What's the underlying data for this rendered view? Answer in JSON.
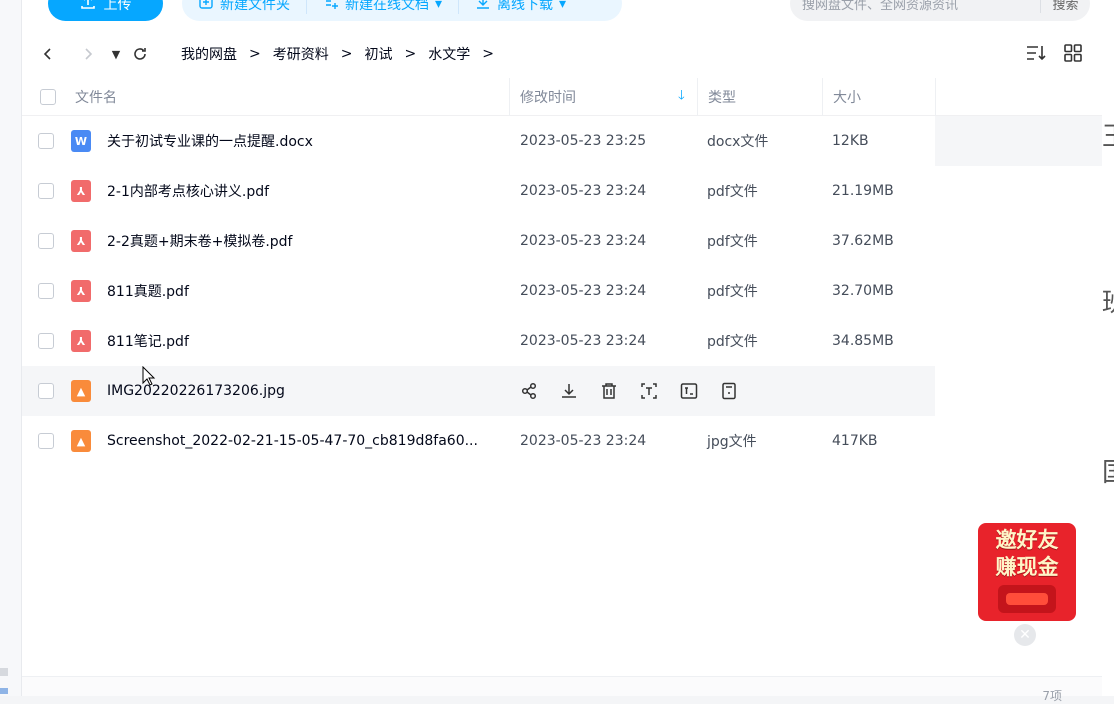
{
  "toolbar": {
    "upload_label": "上传",
    "new_folder_label": "新建文件夹",
    "new_online_doc_label": "新建在线文档",
    "offline_download_label": "离线下载",
    "search_placeholder": "搜网盘文件、全网资源资讯",
    "search_button": "搜索"
  },
  "breadcrumb": {
    "items": [
      "我的网盘",
      "考研资料",
      "初试",
      "水文学"
    ],
    "separator": ">"
  },
  "table": {
    "headers": {
      "name": "文件名",
      "time": "修改时间",
      "type": "类型",
      "size": "大小"
    },
    "rows": [
      {
        "icon": "word-file-icon",
        "name": "关于初试专业课的一点提醒.docx",
        "time": "2023-05-23 23:25",
        "type": "docx文件",
        "size": "12KB"
      },
      {
        "icon": "pdf-file-icon",
        "name": "2-1内部考点核心讲义.pdf",
        "time": "2023-05-23 23:24",
        "type": "pdf文件",
        "size": "21.19MB"
      },
      {
        "icon": "pdf-file-icon",
        "name": "2-2真题+期末卷+模拟卷.pdf",
        "time": "2023-05-23 23:24",
        "type": "pdf文件",
        "size": "37.62MB"
      },
      {
        "icon": "pdf-file-icon",
        "name": "811真题.pdf",
        "time": "2023-05-23 23:24",
        "type": "pdf文件",
        "size": "32.70MB"
      },
      {
        "icon": "pdf-file-icon",
        "name": "811笔记.pdf",
        "time": "2023-05-23 23:24",
        "type": "pdf文件",
        "size": "34.85MB"
      },
      {
        "icon": "image-file-icon",
        "name": "IMG20220226173206.jpg",
        "time": "",
        "type": "",
        "size": ""
      },
      {
        "icon": "image-file-icon",
        "name": "Screenshot_2022-02-21-15-05-47-70_cb819d8fa60...",
        "time": "2023-05-23 23:24",
        "type": "jpg文件",
        "size": "417KB"
      }
    ]
  },
  "promo": {
    "line1": "邀好友",
    "line2": "赚现金"
  },
  "footer": {
    "count": "7项"
  },
  "right_strip": [
    "王",
    "班",
    "国"
  ],
  "colors": {
    "accent": "#06a7ff",
    "word": "#4a8af4",
    "pdf": "#f16b6b",
    "image": "#f98b3b",
    "promo": "#e8232b"
  }
}
